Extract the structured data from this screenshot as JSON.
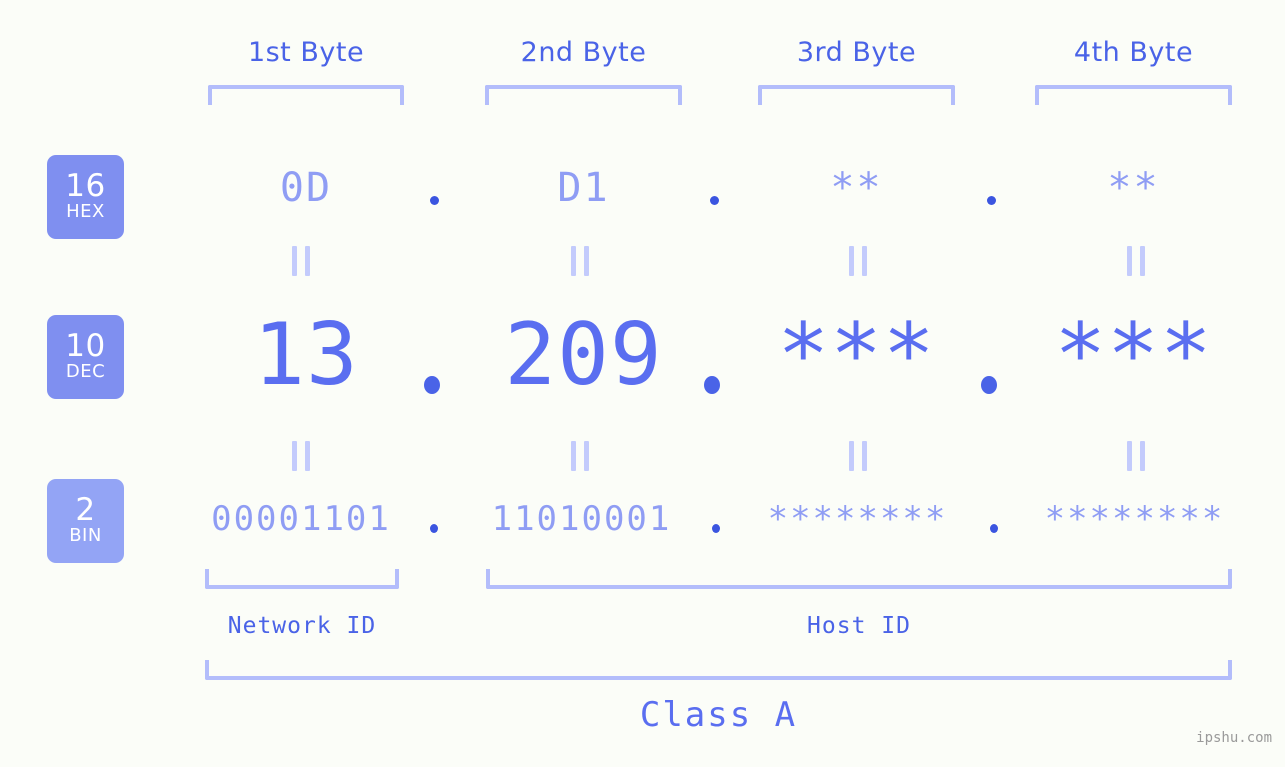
{
  "page": {
    "background_color": "#fbfdf8",
    "accent_color": "#5a6ef0",
    "accent_light_color": "#8f9df4",
    "bracket_color": "#b3bdfb",
    "badge_color": "#7f8ff0"
  },
  "byte_headers": [
    {
      "label": "1st Byte"
    },
    {
      "label": "2nd Byte"
    },
    {
      "label": "3rd Byte"
    },
    {
      "label": "4th Byte"
    }
  ],
  "rows": [
    {
      "id": "hex",
      "badge_number": "16",
      "badge_base": "HEX",
      "octets": [
        "0D",
        "D1",
        "**",
        "**"
      ],
      "separator": "."
    },
    {
      "id": "dec",
      "badge_number": "10",
      "badge_base": "DEC",
      "octets": [
        "13",
        "209",
        "***",
        "***"
      ],
      "separator": "."
    },
    {
      "id": "bin",
      "badge_number": "2",
      "badge_base": "BIN",
      "octets": [
        "00001101",
        "11010001",
        "********",
        "********"
      ],
      "separator": "."
    }
  ],
  "equivalence_symbol": "=",
  "sections": [
    {
      "label": "Network ID"
    },
    {
      "label": "Host ID"
    }
  ],
  "class": {
    "label": "Class A"
  },
  "watermark": {
    "text": "ipshu.com"
  }
}
